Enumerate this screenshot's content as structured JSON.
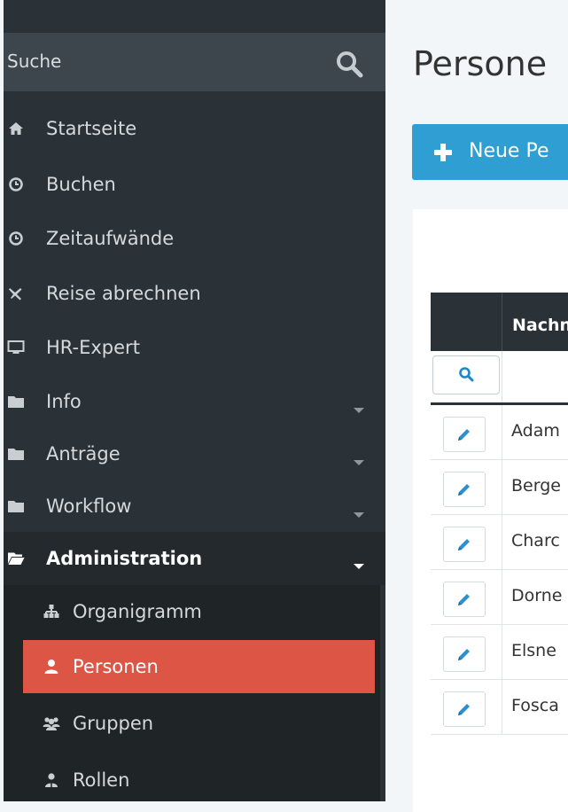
{
  "sidebar": {
    "search_label": "Suche",
    "items": [
      {
        "label": "Startseite",
        "icon": "home-icon"
      },
      {
        "label": "Buchen",
        "icon": "clock-icon"
      },
      {
        "label": "Zeitaufwände",
        "icon": "clock-icon"
      },
      {
        "label": "Reise abrechnen",
        "icon": "plane-icon"
      },
      {
        "label": "HR-Expert",
        "icon": "monitor-icon"
      },
      {
        "label": "Info",
        "icon": "folder-icon"
      },
      {
        "label": "Anträge",
        "icon": "folder-icon"
      },
      {
        "label": "Workflow",
        "icon": "folder-icon"
      },
      {
        "label": "Administration",
        "icon": "folder-open-icon"
      }
    ],
    "submenu": [
      {
        "label": "Organigramm",
        "icon": "sitemap-icon"
      },
      {
        "label": "Personen",
        "icon": "user-icon",
        "active": true
      },
      {
        "label": "Gruppen",
        "icon": "users-icon"
      },
      {
        "label": "Rollen",
        "icon": "roles-icon"
      }
    ]
  },
  "main": {
    "title": "Persone",
    "new_button_label": "Neue Pe",
    "table": {
      "columns": [
        "Nachn"
      ],
      "rows": [
        "Adam",
        "Berge",
        "Charc",
        "Dorne",
        "Elsne",
        "Fosca"
      ]
    }
  },
  "colors": {
    "sidebar_bg": "#2b3237",
    "active_item": "#dd5544",
    "primary_button": "#2f9fd3"
  }
}
